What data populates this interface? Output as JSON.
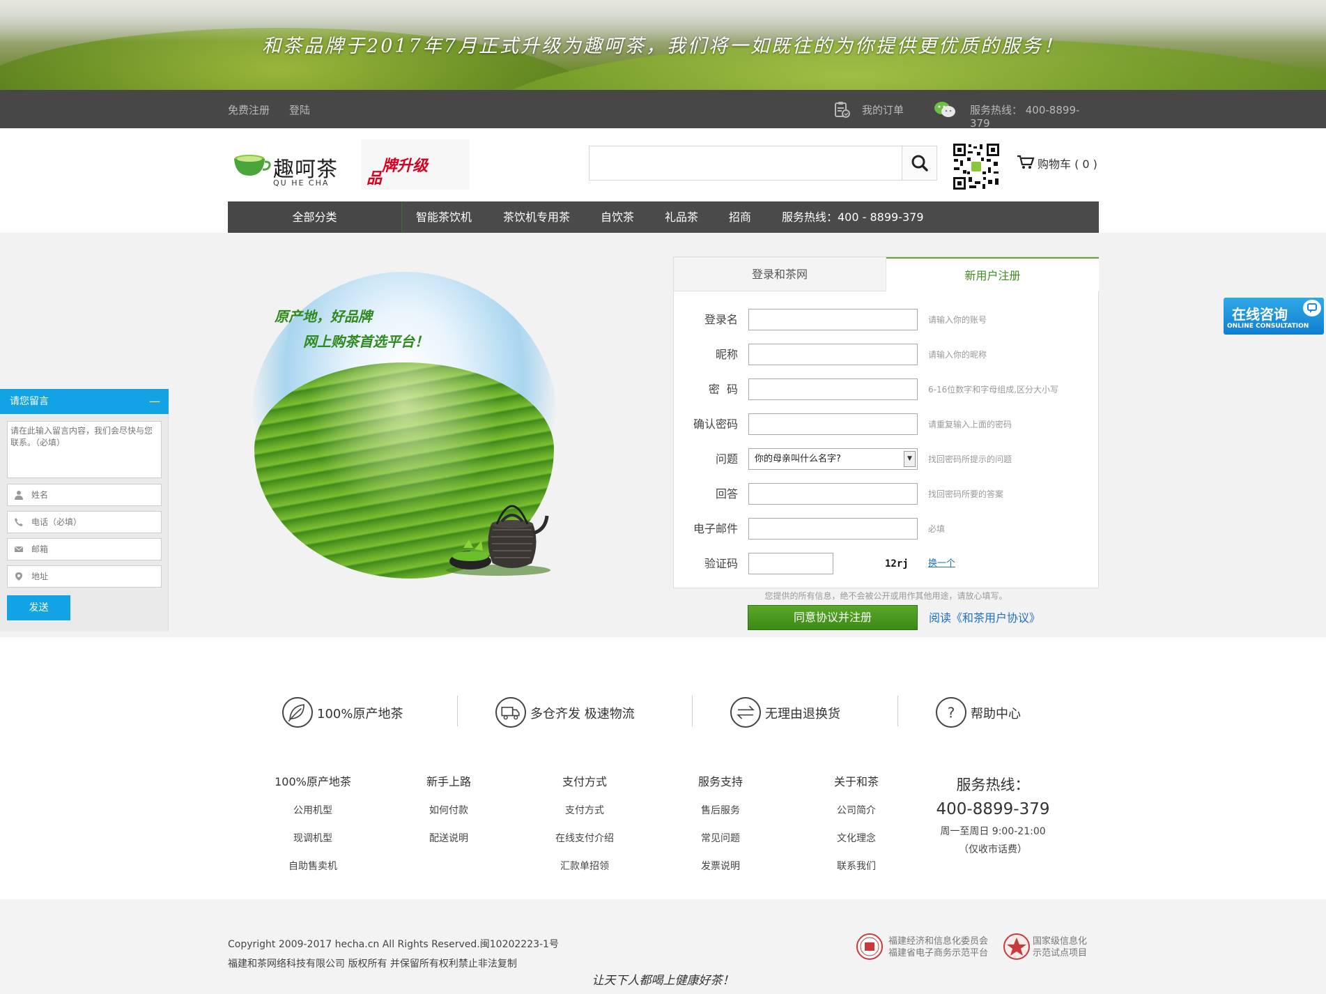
{
  "banner": {
    "slogan": "和茶品牌于2017年7月正式升级为趣呵茶，我们将一如既往的为你提供更优质的服务！"
  },
  "topbar": {
    "register": "免费注册",
    "login": "登陆",
    "orders": "我的订单",
    "hotline": "服务热线： 400-8899-379",
    "icons": [
      "clipboard-icon",
      "wechat-icon"
    ]
  },
  "header": {
    "logo_text": "趣呵茶",
    "logo_sub": "QU HE CHA",
    "upgrade_a": "牌升级",
    "upgrade_b": "品",
    "search_placeholder": "",
    "cart": "购物车 ( 0 )"
  },
  "nav": {
    "all": "全部分类",
    "items": [
      "智能茶饮机",
      "茶饮机专用茶",
      "自饮茶",
      "礼品茶",
      "招商",
      "服务热线：400 - 8899-379"
    ]
  },
  "promo": {
    "line1": "原产地，好品牌",
    "line2": "网上购茶首选平台！"
  },
  "form": {
    "tab_login": "登录和茶网",
    "tab_register": "新用户注册",
    "fields": [
      {
        "label": "登录名",
        "hint": "请输入你的账号"
      },
      {
        "label": "昵称",
        "hint": "请输入你的昵称"
      },
      {
        "label": "密  码",
        "hint": "6-16位数字和字母组成,区分大小写"
      },
      {
        "label": "确认密码",
        "hint": "请重复输入上面的密码"
      },
      {
        "label": "问题",
        "hint": "找回密码所提示的问题",
        "selected": "你的母亲叫什么名字?"
      },
      {
        "label": "回答",
        "hint": "找回密码所要的答案"
      },
      {
        "label": "电子邮件",
        "hint": "必填"
      },
      {
        "label": "验证码",
        "captcha": "12rj",
        "swap": "换一个"
      }
    ],
    "privacy": "您提供的所有信息，绝不会被公开或用作其他用途，请放心填写。",
    "submit": "同意协议并注册",
    "agreement": "阅读《和茶用户协议》"
  },
  "message": {
    "title": "请您留言",
    "minimize": "—",
    "content_placeholder": "请在此输入留言内容，我们会尽快与您联系。（必填）",
    "name_placeholder": "姓名",
    "phone_placeholder": "电话（必填）",
    "email_placeholder": "邮箱",
    "address_placeholder": "地址",
    "send": "发送"
  },
  "consult": {
    "title": "在线咨询",
    "sub": "ONLINE CONSULTATION"
  },
  "features": [
    {
      "label": "100%原产地茶",
      "icon": "leaf-icon"
    },
    {
      "label": "多仓齐发 极速物流",
      "icon": "truck-icon"
    },
    {
      "label": "无理由退换货",
      "icon": "exchange-icon"
    },
    {
      "label": "帮助中心",
      "icon": "question-icon"
    }
  ],
  "footer_cols": [
    {
      "title": "100%原产地茶",
      "links": [
        "公用机型",
        "现调机型",
        "自助售卖机"
      ]
    },
    {
      "title": "新手上路",
      "links": [
        "如何付款",
        "配送说明"
      ]
    },
    {
      "title": "支付方式",
      "links": [
        "支付方式",
        "在线支付介绍",
        "汇款单招领"
      ]
    },
    {
      "title": "服务支持",
      "links": [
        "售后服务",
        "常见问题",
        "发票说明"
      ]
    },
    {
      "title": "关于和茶",
      "links": [
        "公司简介",
        "文化理念",
        "联系我们"
      ]
    }
  ],
  "hotline": {
    "title": "服务热线：",
    "number": "400-8899-379",
    "hours": "周一至周日 9:00-21:00",
    "note": "（仅收市话费）"
  },
  "bottom": {
    "copyright": "Copyright 2009-2017 hecha.cn All Rights Reserved.闽10202223-1号",
    "company": "福建和茶网络科技有限公司 版权所有 并保留所有权利禁止非法复制",
    "seal1_line1": "福建经济和信息化委员会",
    "seal1_line2": "福建省电子商务示范平台",
    "seal2_line1": "国家级信息化",
    "seal2_line2": "示范试点项目",
    "motto": "让天下人都喝上健康好茶！"
  }
}
